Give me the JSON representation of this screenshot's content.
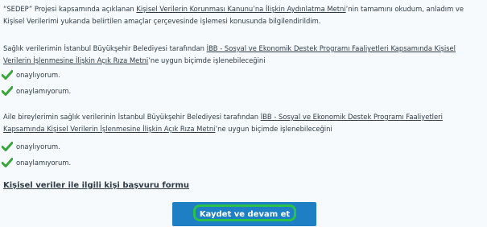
{
  "intro": {
    "prefix": "“SEDEP” Projesi kapsamında açıklanan ",
    "link": "Kişisel Verilerin Korunması Kanunu’na İlişkin Aydınlatma Metni",
    "suffix": "’nin tamamını okudum, anladım ve Kişisel Verilerimi yukarıda belirtilen amaçlar çerçevesinde işlemesi konusunda bilgilendirildim."
  },
  "consent_health": {
    "prefix": "Sağlık verilerimin İstanbul Büyükşehir Belediyesi tarafından ",
    "link": "İBB - Sosyal ve Ekonomik Destek Programı Faaliyetleri Kapsamında Kişisel Verilerin İşlenmesine İlişkin Açık Rıza Metni",
    "suffix": "’ne uygun biçimde işlenebileceğini",
    "options": [
      "onaylıyorum.",
      "onaylamıyorum."
    ]
  },
  "consent_family": {
    "prefix": "Aile bireylerimin sağlık verilerinin İstanbul Büyükşehir Belediyesi tarafından ",
    "link": "İBB - Sosyal ve Ekonomik Destek Programı Faaliyetleri Kapsamında Kişisel Verilerin İşlenmesine İlişkin Açık Rıza Metni",
    "suffix": "’ne uygun biçimde işlenebileceğini",
    "options": [
      "onaylıyorum.",
      "onaylamıyorum."
    ]
  },
  "form_link": "Kişisel veriler ile ilgili kişi başvuru formu",
  "submit_button": "Kaydet ve devam et",
  "colors": {
    "check": "#3aa53a",
    "button": "#1f7fc4",
    "button_highlight": "#29c14a"
  },
  "icons": {
    "check": "check-icon"
  }
}
